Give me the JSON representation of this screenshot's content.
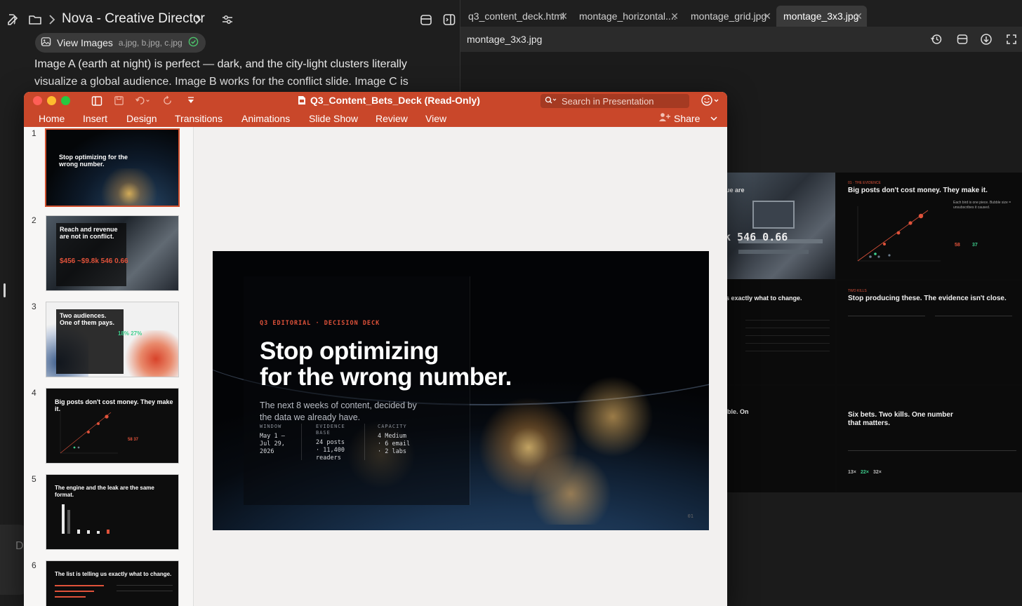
{
  "chat": {
    "title": "Nova - Creative Director",
    "chip_label": "View Images",
    "chip_files": "a.jpg, b.jpg, c.jpg",
    "message": "Image A (earth at night) is perfect — dark, and the city-light clusters literally visualize a global audience. Image B works for the conflict slide. Image C is",
    "composer_char": "D"
  },
  "viewer": {
    "tabs": [
      {
        "label": "q3_content_deck.html"
      },
      {
        "label": "montage_horizontal...."
      },
      {
        "label": "montage_grid.jpg"
      },
      {
        "label": "montage_3x3.jpg"
      }
    ],
    "filename": "montage_3x3.jpg",
    "montage": {
      "c1_title": "ue are",
      "c1_nums": "k 546 0.66",
      "c2_title": "Big posts don't cost money. They make it.",
      "c3_title": "s exactly what to change.",
      "c4_title": "Stop producing these. The evidence isn't close.",
      "c5_title": "ble. On",
      "c6_title": "Six bets. Two kills. One number that matters.",
      "c2_nums": [
        "58",
        "37"
      ],
      "c6_nums": [
        "13×",
        "22×",
        "32×"
      ]
    }
  },
  "ppt": {
    "title": "Q3_Content_Bets_Deck (Read-Only)",
    "search_placeholder": "Search in Presentation",
    "ribbon": [
      "Home",
      "Insert",
      "Design",
      "Transitions",
      "Animations",
      "Slide Show",
      "Review",
      "View"
    ],
    "share": "Share",
    "thumbnails": [
      {
        "num": "1",
        "title": "Stop optimizing for the wrong number."
      },
      {
        "num": "2",
        "title": "Reach and revenue are not in conflict.",
        "nums": "$456 ~$9.8k 546 0.66"
      },
      {
        "num": "3",
        "title": "Two audiences. One of them pays.",
        "nums": "18% 27%"
      },
      {
        "num": "4",
        "title": "Big posts don't cost money. They make it.",
        "nums": "58 37"
      },
      {
        "num": "5",
        "title": "The engine and the leak are the same format."
      },
      {
        "num": "6",
        "title": "The list is telling us exactly what to change."
      }
    ],
    "slide": {
      "eyebrow": "Q3 EDITORIAL · DECISION DECK",
      "title_line1": "Stop optimizing",
      "title_line2": "for the wrong number.",
      "subtitle": "The next 8 weeks of content, decided by the data we already have.",
      "window_label": "WINDOW",
      "window_value_1": "May 1 –",
      "window_value_2": "Jul 29,",
      "window_value_3": "2026",
      "evidence_label_1": "EVIDENCE",
      "evidence_label_2": "BASE",
      "evidence_value_1": "24 posts",
      "evidence_value_2": "· 11,400",
      "evidence_value_3": "readers",
      "capacity_label": "CAPACITY",
      "capacity_value_1": "4 Medium",
      "capacity_value_2": "· 6 email",
      "capacity_value_3": "· 2 labs",
      "slide_number": "01"
    }
  },
  "colors": {
    "ppt_accent": "#c9472a",
    "slide_eyebrow": "#e0523a",
    "chart_green": "#3ecf8e"
  }
}
